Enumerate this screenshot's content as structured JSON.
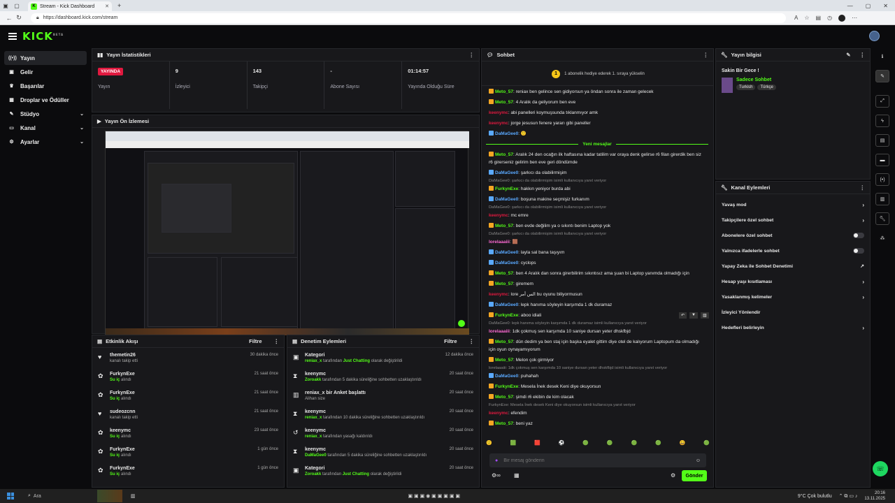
{
  "browser": {
    "tab_title": "Stream - Kick Dashboard",
    "url": "https://dashboard.kick.com/stream"
  },
  "header": {
    "logo": "KICK",
    "logo_sup": "BETA"
  },
  "sidebar": {
    "items": [
      {
        "label": "Yayın",
        "icon": "broadcast-icon"
      },
      {
        "label": "Gelir",
        "icon": "wallet-icon"
      },
      {
        "label": "Başarılar",
        "icon": "trophy-icon"
      },
      {
        "label": "Droplar ve Ödüller",
        "icon": "gift-icon"
      },
      {
        "label": "Stüdyo",
        "icon": "studio-icon"
      },
      {
        "label": "Kanal",
        "icon": "channel-icon"
      },
      {
        "label": "Ayarlar",
        "icon": "gear-icon"
      }
    ]
  },
  "stats": {
    "title": "Yayın İstatistikleri",
    "items": [
      {
        "value": "YAYINDA",
        "label": "Yayın"
      },
      {
        "value": "9",
        "label": "İzleyici"
      },
      {
        "value": "143",
        "label": "Takipçi"
      },
      {
        "value": "-",
        "label": "Abone Sayısı"
      },
      {
        "value": "01:14:57",
        "label": "Yayında Olduğu Süre"
      }
    ]
  },
  "preview": {
    "title": "Yayın Ön İzlemesi"
  },
  "activity": {
    "title": "Etkinlik Akışı",
    "filter": "Filtre",
    "items": [
      {
        "name": "themetin26",
        "sub": "kanalı takip etti",
        "time": "30 dakika önce",
        "icon": "heart-icon"
      },
      {
        "name": "FurkynExe",
        "sub_hl": "Su iç",
        "sub": "alındı",
        "time": "21 saat önce",
        "icon": "reward-icon"
      },
      {
        "name": "FurkynExe",
        "sub_hl": "Su iç",
        "sub": "alındı",
        "time": "21 saat önce",
        "icon": "reward-icon"
      },
      {
        "name": "sudeozcnn",
        "sub": "kanalı takip etti",
        "time": "21 saat önce",
        "icon": "heart-icon"
      },
      {
        "name": "keenymc",
        "sub_hl": "Su iç",
        "sub": "alındı",
        "time": "23 saat önce",
        "icon": "reward-icon"
      },
      {
        "name": "FurkynExe",
        "sub_hl": "Su iç",
        "sub": "alındı",
        "time": "1 gün önce",
        "icon": "reward-icon"
      },
      {
        "name": "FurkynExe",
        "sub_hl": "Su iç",
        "sub": "alındı",
        "time": "1 gün önce",
        "icon": "reward-icon"
      }
    ]
  },
  "moderation": {
    "title": "Denetim Eylemleri",
    "filter": "Filtre",
    "items": [
      {
        "name": "Kategori",
        "l1": "reniax_x",
        "l2": " tarafından ",
        "l3": "Just Chatting",
        "l4": " olarak değiştirildi",
        "time": "12 dakika önce",
        "icon": "category-icon"
      },
      {
        "name": "keenymc",
        "l1": "Zoroakk",
        "l2": " tarafından 5 dakika süreliğine sohbetten uzaklaştırıldı",
        "l3": "",
        "l4": "",
        "time": "20 saat önce",
        "icon": "timeout-icon"
      },
      {
        "name": "reniax_x bir Anket başlattı",
        "l1": "",
        "l2": "Alihan size",
        "l3": "",
        "l4": "",
        "time": "20 saat önce",
        "icon": "poll-icon"
      },
      {
        "name": "keenymc",
        "l1": "reniax_x",
        "l2": " tarafından 10 dakika süreliğine sohbetten uzaklaştırıldı",
        "l3": "",
        "l4": "",
        "time": "20 saat önce",
        "icon": "timeout-icon"
      },
      {
        "name": "keenymc",
        "l1": "reniax_x",
        "l2": " tarafından yasağı kaldırıldı",
        "l3": "",
        "l4": "",
        "time": "20 saat önce",
        "icon": "unban-icon"
      },
      {
        "name": "keenymc",
        "l1": "DaMaGee0",
        "l2": " tarafından 5 dakika süreliğine sohbetten uzaklaştırıldı",
        "l3": "",
        "l4": "",
        "time": "20 saat önce",
        "icon": "timeout-icon"
      },
      {
        "name": "Kategori",
        "l1": "Zoroakk",
        "l2": " tarafından ",
        "l3": "Just Chatting",
        "l4": " olarak değiştirildi",
        "time": "20 saat önce",
        "icon": "category-icon"
      }
    ]
  },
  "chat": {
    "title": "Sohbet",
    "pinned": "1 abonelik hediye ederek 1. sıraya yükselin",
    "new_messages": "Yeni mesajlar",
    "placeholder": "Bir mesaj gönderin",
    "send": "Gönder",
    "top": [
      {
        "u": "Meto_57",
        "c": "#53fc18",
        "b": "#f5a623",
        "t": ": reniax ben gelince sen gidiyorsun ya öndan sonra ile zaman gelecek"
      },
      {
        "u": "Meto_57",
        "c": "#53fc18",
        "b": "#f5a623",
        "t": ": 4 Aralık da geliyorum ben eve"
      },
      {
        "u": "keenymc",
        "c": "#e0193f",
        "b": "",
        "t": ": abi panelleri koymuşsunda tıklanmıyor amk"
      },
      {
        "u": "keenymc",
        "c": "#e0193f",
        "b": "",
        "t": ": jorge jesusun fenere yararı gibi paneller"
      },
      {
        "u": "DaMaGee0",
        "c": "#5aa9ff",
        "b": "#5aa9ff",
        "t": ": 🙂"
      }
    ],
    "bottom": [
      {
        "u": "Meto_57",
        "c": "#53fc18",
        "b": "#f5a623",
        "t": ": Aralık 24 den ocağın ilk haftasına kadar tatilim var oraya denk gelirse r6 filan girerdik ben siz r6 girerseniz gelirim ben eve geri döndümde"
      },
      {
        "u": "DaMaGee0",
        "c": "#5aa9ff",
        "b": "#5aa9ff",
        "t": ": şarkıcı da olabilirmişim"
      },
      {
        "reply": "DaMaGee0: şarkıcı da olabilirmişim isimli kullanıcıya yanıt veriyor"
      },
      {
        "u": "FurkynExe",
        "c": "#53fc18",
        "b": "#f5a623",
        "t": ": hakkın yeniyor burda abi"
      },
      {
        "u": "DaMaGee0",
        "c": "#5aa9ff",
        "b": "#5aa9ff",
        "t": ": boşuna makine seçmişiz furkanım"
      },
      {
        "reply": "DaMaGee0: şarkıcı da olabilirmişim isimli kullanıcıya yanıt veriyor"
      },
      {
        "u": "keenymc",
        "c": "#e0193f",
        "b": "",
        "t": ": mc emre"
      },
      {
        "u": "Meto_57",
        "c": "#53fc18",
        "b": "#f5a623",
        "t": ": ben evde değilim ya o sıkıntı benim Laptop yok"
      },
      {
        "reply": "DaMaGee0: şarkıcı da olabilirmişim isimli kullanıcıya yanıt veriyor"
      },
      {
        "u": "lorelaaaiii",
        "c": "#ff6ad5",
        "b": "",
        "t": ": 🟫"
      },
      {
        "u": "DaMaGee0",
        "c": "#5aa9ff",
        "b": "#5aa9ff",
        "t": ": layla sal bana taşıyım"
      },
      {
        "u": "DaMaGee0",
        "c": "#5aa9ff",
        "b": "#5aa9ff",
        "t": ": cyclops"
      },
      {
        "u": "Meto_57",
        "c": "#53fc18",
        "b": "#f5a623",
        "t": ": ben 4 Aralık dan sonra girerbilirim sıkıntısız ama şuan bi Laptop yanımda olmadığı için"
      },
      {
        "u": "Meto_57",
        "c": "#53fc18",
        "b": "#f5a623",
        "t": ": giremem"
      },
      {
        "u": "keenymc",
        "c": "#e0193f",
        "b": "",
        "t": ": lore الس أمر bu oyunu biliyormusun"
      },
      {
        "u": "DaMaGee0",
        "c": "#5aa9ff",
        "b": "#5aa9ff",
        "t": ": lepk hanıma söyleyin karşımda 1 dk duramaz"
      },
      {
        "u": "FurkynExe",
        "c": "#53fc18",
        "b": "#f5a623",
        "t": ": aboo idiali"
      },
      {
        "reply": "DaMaGee0: lepk hanıma söyleyin karşımda 1 dk duramaz isimli kullanıcıya yanıt veriyor"
      },
      {
        "u": "lorelaaaiii",
        "c": "#ff6ad5",
        "b": "",
        "t": ": 1dk çokmuş sen karşımda 10 saniye dursan yeter dhskfbjd"
      },
      {
        "u": "Meto_57",
        "c": "#53fc18",
        "b": "#f5a623",
        "t": ": dün dedim ya ben staj için başka eyalet gittim diye otel de kalıyorum Laptopum da olmadığı için oyun oynayamıyorum"
      },
      {
        "u": "Meto_57",
        "c": "#53fc18",
        "b": "#f5a623",
        "t": ": Melon çok girmiyor"
      },
      {
        "reply": "lorelaaaiii: 1dk çokmuş sen karşımda 10 saniye dursan yeter dhskfbjd isimli kullanıcıya yanıt veriyor"
      },
      {
        "u": "DaMaGee0",
        "c": "#5aa9ff",
        "b": "#5aa9ff",
        "t": ": puhahah"
      },
      {
        "u": "FurkynExe",
        "c": "#53fc18",
        "b": "#f5a623",
        "t": ": Mesela İnek desek Keni diye okuyorsun"
      },
      {
        "u": "Meto_57",
        "c": "#53fc18",
        "b": "#f5a623",
        "t": ": şimdi r6 ekibin de kim olacak"
      },
      {
        "reply": "FurkynExe: Mesela İnek desek Keni diye okuyorsun isimli kullanıcıya yanıt veriyor"
      },
      {
        "u": "keenymc",
        "c": "#e0193f",
        "b": "",
        "t": ": efendim"
      },
      {
        "u": "Meto_57",
        "c": "#53fc18",
        "b": "#f5a623",
        "t": ": beni yaz"
      }
    ]
  },
  "stream_info": {
    "title": "Yayın bilgisi",
    "stream_title": "Sakin Bir Gece !",
    "category": "Sadece Sohbet",
    "tags": [
      "Turkish",
      "Türkçe"
    ]
  },
  "channel_actions": {
    "title": "Kanal Eylemleri",
    "items": [
      {
        "label": "Yavaş mod",
        "kind": "arrow"
      },
      {
        "label": "Takipçilere özel sohbet",
        "kind": "arrow"
      },
      {
        "label": "Abonelere özel sohbet",
        "kind": "toggle"
      },
      {
        "label": "Yalnızca ifadelerle sohbet",
        "kind": "toggle"
      },
      {
        "label": "Yapay Zeka ile Sohbet Denetimi",
        "kind": "ext"
      },
      {
        "label": "Hesap yaşı kısıtlaması",
        "kind": "arrow"
      },
      {
        "label": "Yasaklanmış kelimeler",
        "kind": "arrow"
      },
      {
        "label": "İzleyici Yönlendir",
        "kind": "none"
      },
      {
        "label": "Hedefleri belirleyin",
        "kind": "arrow"
      }
    ]
  },
  "taskbar": {
    "search": "Ara",
    "weather": "9°C  Çok bulutlu",
    "time": "20:16",
    "date": "13.11.2025"
  }
}
